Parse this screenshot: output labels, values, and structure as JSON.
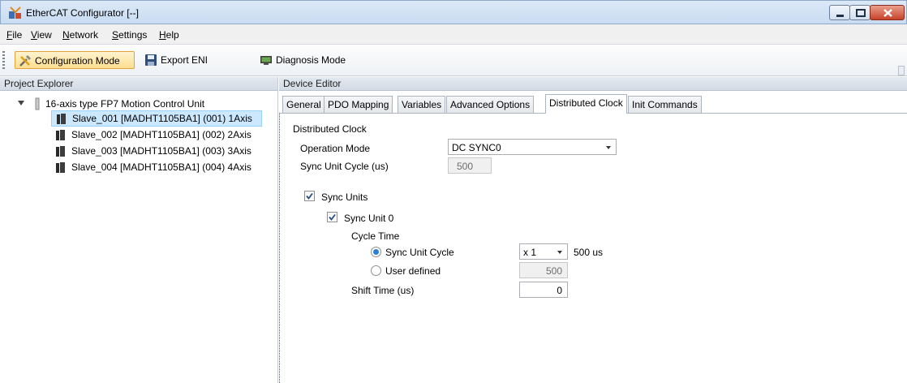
{
  "window": {
    "title": "EtherCAT Configurator [--]"
  },
  "menu": [
    {
      "label": "File",
      "key": "F",
      "rest": "ile"
    },
    {
      "label": "View",
      "key": "V",
      "rest": "iew"
    },
    {
      "label": "Network",
      "key": "N",
      "rest": "etwork"
    },
    {
      "label": "Settings",
      "key": "S",
      "rest": "ettings"
    },
    {
      "label": "Help",
      "key": "H",
      "rest": "elp"
    }
  ],
  "toolbar": {
    "config_mode": "Configuration Mode",
    "export_eni": "Export ENI",
    "diagnosis_mode": "Diagnosis Mode"
  },
  "project_explorer": {
    "header": "Project Explorer",
    "root": "16-axis type FP7 Motion Control Unit",
    "items": [
      {
        "label": "Slave_001 [MADHT1105BA1] (001) 1Axis",
        "selected": true
      },
      {
        "label": "Slave_002 [MADHT1105BA1] (002) 2Axis",
        "selected": false
      },
      {
        "label": "Slave_003 [MADHT1105BA1] (003) 3Axis",
        "selected": false
      },
      {
        "label": "Slave_004 [MADHT1105BA1] (004) 4Axis",
        "selected": false
      }
    ]
  },
  "device_editor": {
    "header": "Device Editor",
    "tabs": [
      "General",
      "PDO Mapping",
      "Variables",
      "Advanced Options",
      "Distributed Clock",
      "Init Commands"
    ],
    "active_tab": "Distributed Clock",
    "dc": {
      "section_title": "Distributed Clock",
      "operation_mode_label": "Operation Mode",
      "operation_mode_value": "DC SYNC0",
      "sync_unit_cycle_label": "Sync Unit Cycle (us)",
      "sync_unit_cycle_value": "500",
      "sync_units_label": "Sync Units",
      "sync_units_checked": true,
      "sync_unit0_label": "Sync Unit 0",
      "sync_unit0_checked": true,
      "cycle_time_label": "Cycle Time",
      "radio_sync_unit_cycle": "Sync Unit Cycle",
      "radio_user_defined": "User defined",
      "multiplier_value": "x 1",
      "multiplier_result": "500 us",
      "user_defined_value": "500",
      "shift_time_label": "Shift Time (us)",
      "shift_time_value": "0"
    }
  },
  "colors": {
    "selection_bg": "#cce8ff",
    "active_mode_bg": "#fddf90",
    "radio_accent": "#2b7fd6"
  }
}
